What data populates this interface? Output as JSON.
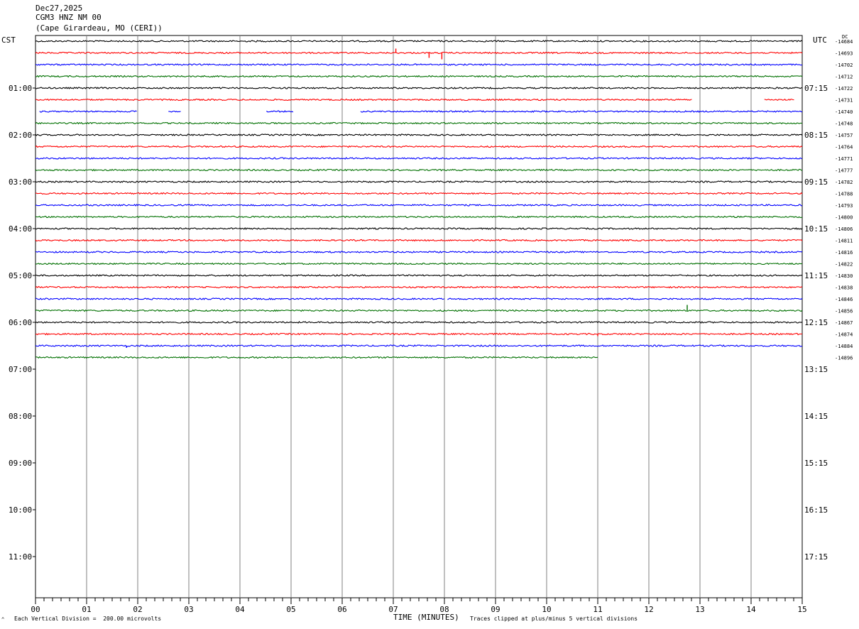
{
  "header": {
    "date": "Dec27,2025",
    "station": "CGM3 HNZ NM 00",
    "location": "(Cape Girardeau, MO (CERI))"
  },
  "timezones": {
    "left": "CST",
    "right": "UTC"
  },
  "dc_label": "DC",
  "footer": {
    "division": "Each Vertical Division =  200.00 microvolts",
    "xlabel": "TIME (MINUTES)",
    "clip_note": "Traces clipped at plus/minus 5 vertical divisions",
    "mark": "^"
  },
  "chart_data": {
    "type": "line",
    "title": "CGM3 HNZ NM 00",
    "xlabel": "TIME (MINUTES)",
    "x_ticks": [
      "00",
      "01",
      "02",
      "03",
      "04",
      "05",
      "06",
      "07",
      "08",
      "09",
      "10",
      "11",
      "12",
      "13",
      "14",
      "15"
    ],
    "xlim": [
      0,
      15
    ],
    "rows_per_hour": 4,
    "left_hour_labels": [
      "01:00",
      "02:00",
      "03:00",
      "04:00",
      "05:00",
      "06:00",
      "07:00",
      "08:00",
      "09:00",
      "10:00",
      "11:00"
    ],
    "right_hour_labels": [
      "07:15",
      "08:15",
      "09:15",
      "10:15",
      "11:15",
      "12:15",
      "13:15",
      "14:15",
      "15:15",
      "16:15",
      "17:15"
    ],
    "trace_colors": [
      "#000000",
      "#ff0000",
      "#0000ff",
      "#007000"
    ],
    "grid": true,
    "series": [
      {
        "dc": "-14684",
        "end_minute": 15
      },
      {
        "dc": "-14693",
        "end_minute": 15,
        "events": [
          {
            "minute": 7.05,
            "amp": 6
          },
          {
            "minute": 7.7,
            "amp": -7
          },
          {
            "minute": 7.95,
            "amp": -9
          }
        ]
      },
      {
        "dc": "-14702",
        "end_minute": 15
      },
      {
        "dc": "-14712",
        "end_minute": 15
      },
      {
        "dc": "-14722",
        "end_minute": 15
      },
      {
        "dc": "-14731",
        "end_minute": 14.85,
        "gaps": [
          [
            12.85,
            14.25
          ]
        ]
      },
      {
        "dc": "-14740",
        "start_minute": 0.08,
        "end_minute": 15,
        "gaps": [
          [
            2.0,
            2.6
          ],
          [
            2.85,
            4.5
          ],
          [
            5.05,
            6.35
          ]
        ]
      },
      {
        "dc": "-14748",
        "end_minute": 15
      },
      {
        "dc": "-14757",
        "end_minute": 15
      },
      {
        "dc": "-14764",
        "end_minute": 15
      },
      {
        "dc": "-14771",
        "end_minute": 15
      },
      {
        "dc": "-14777",
        "end_minute": 15
      },
      {
        "dc": "-14782",
        "end_minute": 15
      },
      {
        "dc": "-14788",
        "end_minute": 15
      },
      {
        "dc": "-14793",
        "end_minute": 15
      },
      {
        "dc": "-14800",
        "end_minute": 15
      },
      {
        "dc": "-14806",
        "end_minute": 15
      },
      {
        "dc": "-14811",
        "end_minute": 15
      },
      {
        "dc": "-14816",
        "end_minute": 15
      },
      {
        "dc": "-14822",
        "end_minute": 15
      },
      {
        "dc": "-14830",
        "end_minute": 15
      },
      {
        "dc": "-14838",
        "end_minute": 15
      },
      {
        "dc": "-14846",
        "end_minute": 15,
        "gaps": [
          [
            8.0,
            8.05
          ]
        ]
      },
      {
        "dc": "-14856",
        "end_minute": 15,
        "events": [
          {
            "minute": 12.75,
            "amp": 8
          }
        ]
      },
      {
        "dc": "-14867",
        "end_minute": 15
      },
      {
        "dc": "-14874",
        "end_minute": 15,
        "events": [
          {
            "minute": 11.0,
            "amp": -3
          }
        ]
      },
      {
        "dc": "-14884",
        "end_minute": 15,
        "events": [
          {
            "minute": 1.78,
            "amp": -3
          }
        ]
      },
      {
        "dc": "-14896",
        "end_minute": 11.0
      }
    ]
  }
}
